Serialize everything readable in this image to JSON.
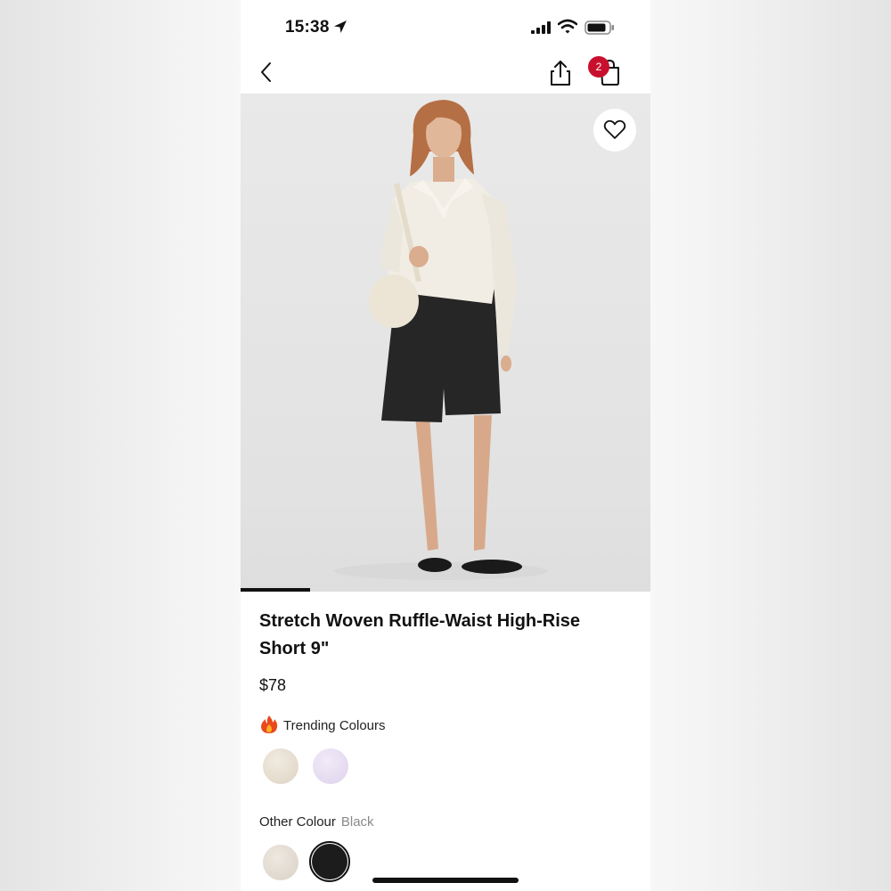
{
  "status_bar": {
    "time": "15:38",
    "location_icon": "location-arrow-icon",
    "signal_icon": "cellular-signal-icon",
    "wifi_icon": "wifi-icon",
    "battery_icon": "battery-icon"
  },
  "nav": {
    "back_icon": "chevron-left-icon",
    "share_icon": "share-icon",
    "bag_icon": "shopping-bag-icon",
    "bag_count": "2"
  },
  "product": {
    "image_alt_icon": "product-photo",
    "favorite_icon": "heart-icon",
    "carousel_progress": 0.17,
    "title": "Stretch Woven Ruffle-Waist High-Rise Short 9\"",
    "price": "$78"
  },
  "trending": {
    "icon": "fire-icon",
    "label": "Trending Colours",
    "swatches": [
      {
        "color": "#e6ded0",
        "selected": false
      },
      {
        "color": "#e8dff2",
        "selected": false
      }
    ]
  },
  "other_colour": {
    "label": "Other Colour",
    "value": "Black",
    "swatches": [
      {
        "color": "#e4ded6",
        "selected": false
      },
      {
        "color": "#1c1c1c",
        "selected": true
      }
    ]
  },
  "colors": {
    "accent_badge": "#c8102e",
    "text_primary": "#111111",
    "text_secondary": "#8a8a8a"
  }
}
